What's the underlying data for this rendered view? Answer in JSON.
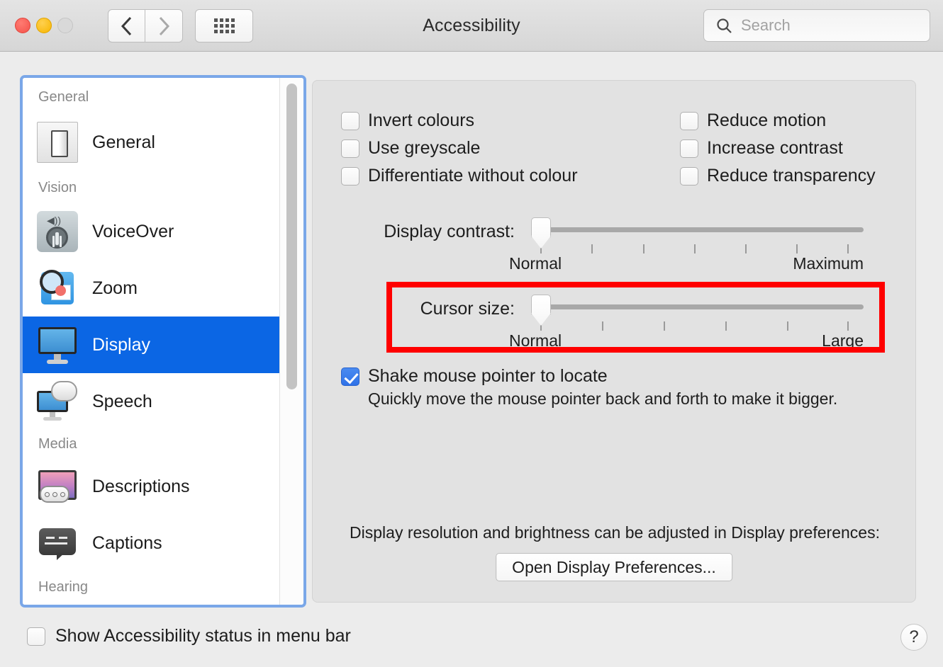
{
  "window": {
    "title": "Accessibility",
    "traffic_lights": [
      "close",
      "minimize",
      "zoom"
    ],
    "nav_back": "‹",
    "nav_forward": "›",
    "grid_button": "show-all"
  },
  "search": {
    "placeholder": "Search",
    "value": "",
    "icon": "search-icon"
  },
  "sidebar": {
    "groups": [
      {
        "header": "General",
        "items": [
          {
            "label": "General",
            "icon": "toggle-switch-icon",
            "selected": false
          }
        ]
      },
      {
        "header": "Vision",
        "items": [
          {
            "label": "VoiceOver",
            "icon": "voiceover-icon",
            "selected": false
          },
          {
            "label": "Zoom",
            "icon": "zoom-magnifier-icon",
            "selected": false
          },
          {
            "label": "Display",
            "icon": "display-monitor-icon",
            "selected": true
          },
          {
            "label": "Speech",
            "icon": "speech-bubble-monitor-icon",
            "selected": false
          }
        ]
      },
      {
        "header": "Media",
        "items": [
          {
            "label": "Descriptions",
            "icon": "descriptions-icon",
            "selected": false
          },
          {
            "label": "Captions",
            "icon": "captions-icon",
            "selected": false
          }
        ]
      },
      {
        "header": "Hearing",
        "items": []
      }
    ],
    "selected_accent": "#0b66e4",
    "focus_ring_color": "#7aa7e8"
  },
  "main": {
    "checkboxes_left": [
      {
        "label": "Invert colours",
        "checked": false
      },
      {
        "label": "Use greyscale",
        "checked": false
      },
      {
        "label": "Differentiate without colour",
        "checked": false
      }
    ],
    "checkboxes_right": [
      {
        "label": "Reduce motion",
        "checked": false
      },
      {
        "label": "Increase contrast",
        "checked": false
      },
      {
        "label": "Reduce transparency",
        "checked": false
      }
    ],
    "display_contrast": {
      "label": "Display contrast:",
      "min_label": "Normal",
      "max_label": "Maximum",
      "value": 0,
      "tick_count": 7,
      "thumb_percent": 0
    },
    "cursor_size": {
      "label": "Cursor size:",
      "min_label": "Normal",
      "max_label": "Large",
      "value": 0,
      "tick_count": 6,
      "thumb_percent": 0,
      "highlighted": true,
      "highlight_color": "#ff0000"
    },
    "shake_pointer": {
      "label": "Shake mouse pointer to locate",
      "checked": true,
      "description": "Quickly move the mouse pointer back and forth to make it bigger."
    },
    "display_note": "Display resolution and brightness can be adjusted in Display preferences:",
    "open_display_button": "Open Display Preferences..."
  },
  "bottom": {
    "menu_bar_checkbox": {
      "label": "Show Accessibility status in menu bar",
      "checked": false
    },
    "help_button": "?"
  }
}
